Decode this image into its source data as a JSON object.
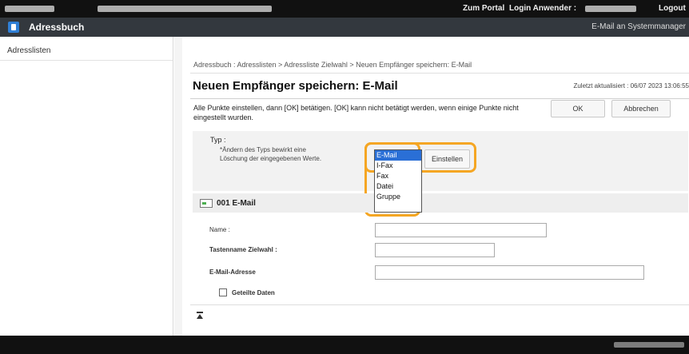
{
  "topbar": {
    "portal_label": "Zum Portal",
    "login_label": "Login Anwender :",
    "logout_label": "Logout"
  },
  "header": {
    "app_title": "Adressbuch",
    "email_admin_link": "E-Mail an Systemmanager"
  },
  "sidebar": {
    "items": [
      {
        "label": "Adresslisten"
      }
    ]
  },
  "main": {
    "breadcrumb": "Adressbuch : Adresslisten > Adressliste Zielwahl > Neuen Empfänger speichern: E-Mail",
    "page_title": "Neuen Empfänger speichern: E-Mail",
    "last_updated": "Zuletzt aktualisiert : 06/07 2023 13:06:55",
    "instructions": "Alle Punkte einstellen, dann [OK] betätigen. [OK] kann nicht betätigt werden, wenn einige Punkte nicht eingestellt wurden.",
    "ok_label": "OK",
    "cancel_label": "Abbrechen",
    "type_label": "Typ :",
    "type_note": "*Ändern des Typs bewirkt eine Löschung der eingegebenen Werte.",
    "type_options": [
      "E-Mail",
      "I-Fax",
      "Fax",
      "Datei",
      "Gruppe"
    ],
    "type_selected": "E-Mail",
    "set_label": "Einstellen",
    "section_title": "001 E-Mail",
    "fields": {
      "name_label": "Name :",
      "name_value": "",
      "key_label": "Tastenname Zielwahl :",
      "key_value": "",
      "email_label": "E-Mail-Adresse",
      "email_value": ""
    },
    "split_data_label": "Geteilte Daten",
    "split_data_checked": false
  },
  "colors": {
    "highlight": "#f5a623",
    "selection": "#2a6fd6",
    "titlebar": "#33383e"
  }
}
